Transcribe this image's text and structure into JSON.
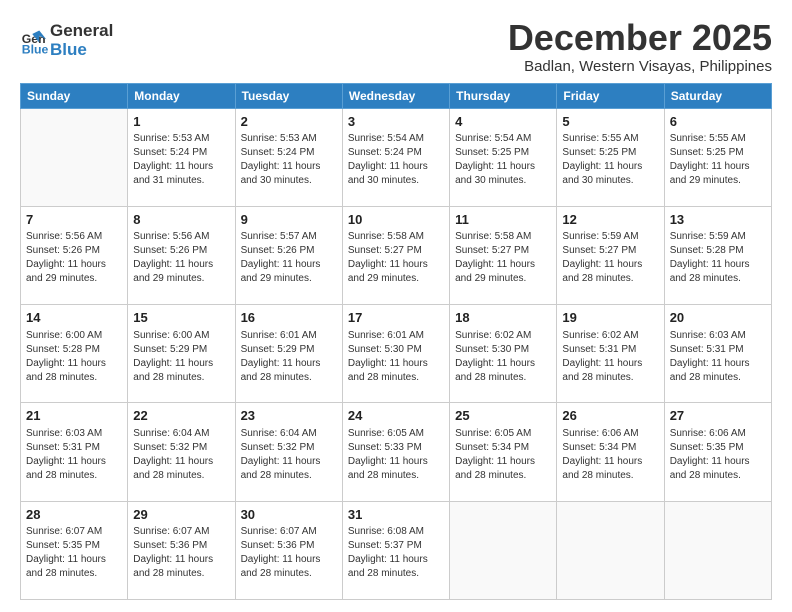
{
  "header": {
    "logo_line1": "General",
    "logo_line2": "Blue",
    "title": "December 2025",
    "subtitle": "Badlan, Western Visayas, Philippines"
  },
  "calendar": {
    "days_of_week": [
      "Sunday",
      "Monday",
      "Tuesday",
      "Wednesday",
      "Thursday",
      "Friday",
      "Saturday"
    ],
    "weeks": [
      [
        {
          "day": "",
          "info": ""
        },
        {
          "day": "1",
          "info": "Sunrise: 5:53 AM\nSunset: 5:24 PM\nDaylight: 11 hours\nand 31 minutes."
        },
        {
          "day": "2",
          "info": "Sunrise: 5:53 AM\nSunset: 5:24 PM\nDaylight: 11 hours\nand 30 minutes."
        },
        {
          "day": "3",
          "info": "Sunrise: 5:54 AM\nSunset: 5:24 PM\nDaylight: 11 hours\nand 30 minutes."
        },
        {
          "day": "4",
          "info": "Sunrise: 5:54 AM\nSunset: 5:25 PM\nDaylight: 11 hours\nand 30 minutes."
        },
        {
          "day": "5",
          "info": "Sunrise: 5:55 AM\nSunset: 5:25 PM\nDaylight: 11 hours\nand 30 minutes."
        },
        {
          "day": "6",
          "info": "Sunrise: 5:55 AM\nSunset: 5:25 PM\nDaylight: 11 hours\nand 29 minutes."
        }
      ],
      [
        {
          "day": "7",
          "info": "Sunrise: 5:56 AM\nSunset: 5:26 PM\nDaylight: 11 hours\nand 29 minutes."
        },
        {
          "day": "8",
          "info": "Sunrise: 5:56 AM\nSunset: 5:26 PM\nDaylight: 11 hours\nand 29 minutes."
        },
        {
          "day": "9",
          "info": "Sunrise: 5:57 AM\nSunset: 5:26 PM\nDaylight: 11 hours\nand 29 minutes."
        },
        {
          "day": "10",
          "info": "Sunrise: 5:58 AM\nSunset: 5:27 PM\nDaylight: 11 hours\nand 29 minutes."
        },
        {
          "day": "11",
          "info": "Sunrise: 5:58 AM\nSunset: 5:27 PM\nDaylight: 11 hours\nand 29 minutes."
        },
        {
          "day": "12",
          "info": "Sunrise: 5:59 AM\nSunset: 5:27 PM\nDaylight: 11 hours\nand 28 minutes."
        },
        {
          "day": "13",
          "info": "Sunrise: 5:59 AM\nSunset: 5:28 PM\nDaylight: 11 hours\nand 28 minutes."
        }
      ],
      [
        {
          "day": "14",
          "info": "Sunrise: 6:00 AM\nSunset: 5:28 PM\nDaylight: 11 hours\nand 28 minutes."
        },
        {
          "day": "15",
          "info": "Sunrise: 6:00 AM\nSunset: 5:29 PM\nDaylight: 11 hours\nand 28 minutes."
        },
        {
          "day": "16",
          "info": "Sunrise: 6:01 AM\nSunset: 5:29 PM\nDaylight: 11 hours\nand 28 minutes."
        },
        {
          "day": "17",
          "info": "Sunrise: 6:01 AM\nSunset: 5:30 PM\nDaylight: 11 hours\nand 28 minutes."
        },
        {
          "day": "18",
          "info": "Sunrise: 6:02 AM\nSunset: 5:30 PM\nDaylight: 11 hours\nand 28 minutes."
        },
        {
          "day": "19",
          "info": "Sunrise: 6:02 AM\nSunset: 5:31 PM\nDaylight: 11 hours\nand 28 minutes."
        },
        {
          "day": "20",
          "info": "Sunrise: 6:03 AM\nSunset: 5:31 PM\nDaylight: 11 hours\nand 28 minutes."
        }
      ],
      [
        {
          "day": "21",
          "info": "Sunrise: 6:03 AM\nSunset: 5:31 PM\nDaylight: 11 hours\nand 28 minutes."
        },
        {
          "day": "22",
          "info": "Sunrise: 6:04 AM\nSunset: 5:32 PM\nDaylight: 11 hours\nand 28 minutes."
        },
        {
          "day": "23",
          "info": "Sunrise: 6:04 AM\nSunset: 5:32 PM\nDaylight: 11 hours\nand 28 minutes."
        },
        {
          "day": "24",
          "info": "Sunrise: 6:05 AM\nSunset: 5:33 PM\nDaylight: 11 hours\nand 28 minutes."
        },
        {
          "day": "25",
          "info": "Sunrise: 6:05 AM\nSunset: 5:34 PM\nDaylight: 11 hours\nand 28 minutes."
        },
        {
          "day": "26",
          "info": "Sunrise: 6:06 AM\nSunset: 5:34 PM\nDaylight: 11 hours\nand 28 minutes."
        },
        {
          "day": "27",
          "info": "Sunrise: 6:06 AM\nSunset: 5:35 PM\nDaylight: 11 hours\nand 28 minutes."
        }
      ],
      [
        {
          "day": "28",
          "info": "Sunrise: 6:07 AM\nSunset: 5:35 PM\nDaylight: 11 hours\nand 28 minutes."
        },
        {
          "day": "29",
          "info": "Sunrise: 6:07 AM\nSunset: 5:36 PM\nDaylight: 11 hours\nand 28 minutes."
        },
        {
          "day": "30",
          "info": "Sunrise: 6:07 AM\nSunset: 5:36 PM\nDaylight: 11 hours\nand 28 minutes."
        },
        {
          "day": "31",
          "info": "Sunrise: 6:08 AM\nSunset: 5:37 PM\nDaylight: 11 hours\nand 28 minutes."
        },
        {
          "day": "",
          "info": ""
        },
        {
          "day": "",
          "info": ""
        },
        {
          "day": "",
          "info": ""
        }
      ]
    ]
  }
}
